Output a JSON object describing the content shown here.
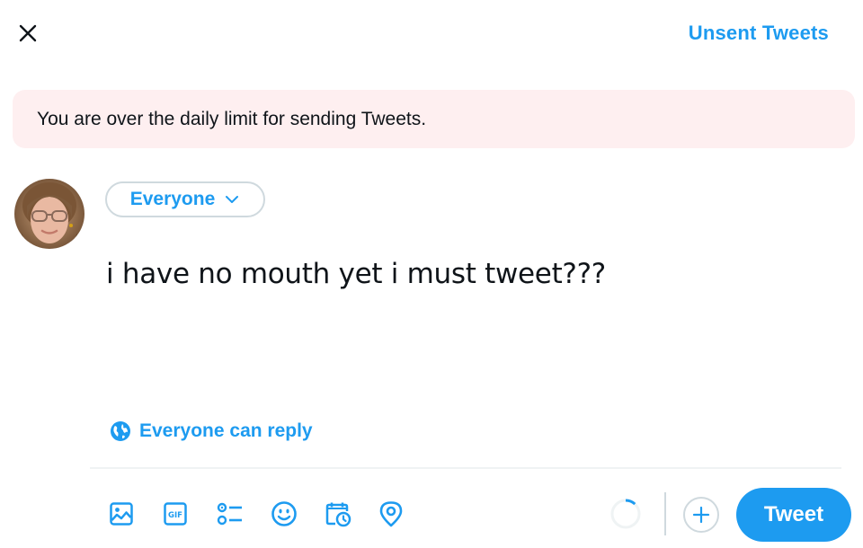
{
  "header": {
    "close_icon": "close-icon",
    "unsent_tweets_label": "Unsent Tweets"
  },
  "alert": {
    "message": "You are over the daily limit for sending Tweets.",
    "background_color": "#feeff0"
  },
  "composer": {
    "avatar_alt": "User avatar",
    "audience_label": "Everyone",
    "tweet_text": "i have no mouth yet i must tweet???",
    "reply_setting_label": "Everyone can reply"
  },
  "toolbar": {
    "tools": [
      {
        "name": "media",
        "icon": "image-icon"
      },
      {
        "name": "gif",
        "icon": "gif-icon",
        "glyph": "GIF"
      },
      {
        "name": "poll",
        "icon": "poll-icon"
      },
      {
        "name": "emoji",
        "icon": "emoji-icon"
      },
      {
        "name": "schedule",
        "icon": "schedule-icon"
      },
      {
        "name": "location",
        "icon": "location-icon"
      }
    ],
    "character_progress_fraction": 0.12,
    "add_tweet_icon": "plus-icon",
    "tweet_button_label": "Tweet"
  },
  "colors": {
    "accent": "#1d9bf0",
    "text": "#0f1419",
    "border": "#cfd9de"
  }
}
